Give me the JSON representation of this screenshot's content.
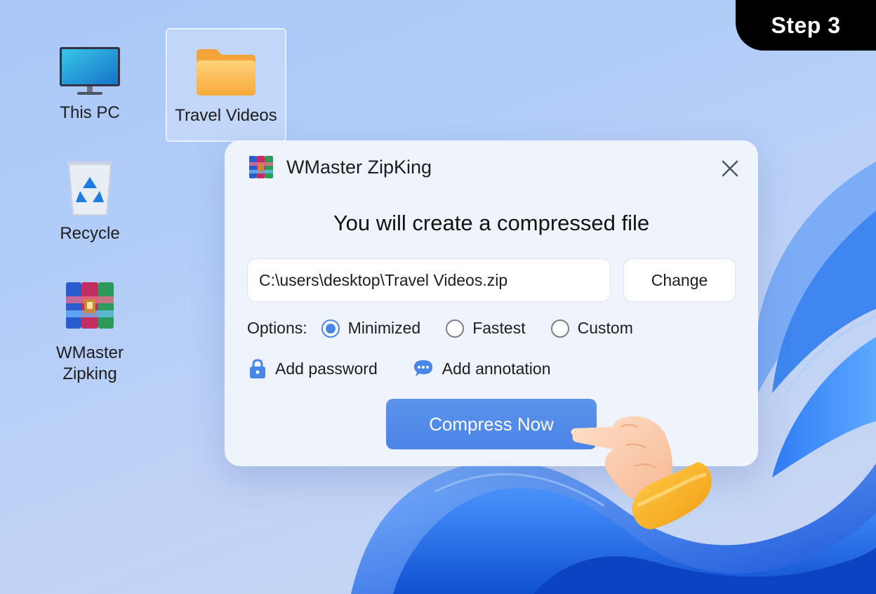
{
  "step_badge": "Step 3",
  "desktop": {
    "icons": [
      {
        "label": "This PC",
        "icon": "monitor-icon"
      },
      {
        "label": "Travel Videos",
        "icon": "folder-icon"
      },
      {
        "label": "Recycle",
        "icon": "recycle-bin-icon"
      },
      {
        "label_line1": "WMaster",
        "label_line2": "Zipking",
        "icon": "archive-books-icon"
      }
    ]
  },
  "dialog": {
    "app_title": "WMaster ZipKing",
    "headline": "You will create a compressed file",
    "path_value": "C:\\users\\desktop\\Travel Videos.zip",
    "change_label": "Change",
    "options_label": "Options:",
    "options": [
      {
        "label": "Minimized",
        "checked": true
      },
      {
        "label": "Fastest",
        "checked": false
      },
      {
        "label": "Custom",
        "checked": false
      }
    ],
    "add_password_label": "Add password",
    "add_annotation_label": "Add annotation",
    "compress_label": "Compress Now"
  },
  "colors": {
    "accent": "#4a86e8",
    "badge_bg": "#000000",
    "wallpaper_blue": "#1f6fe0"
  }
}
